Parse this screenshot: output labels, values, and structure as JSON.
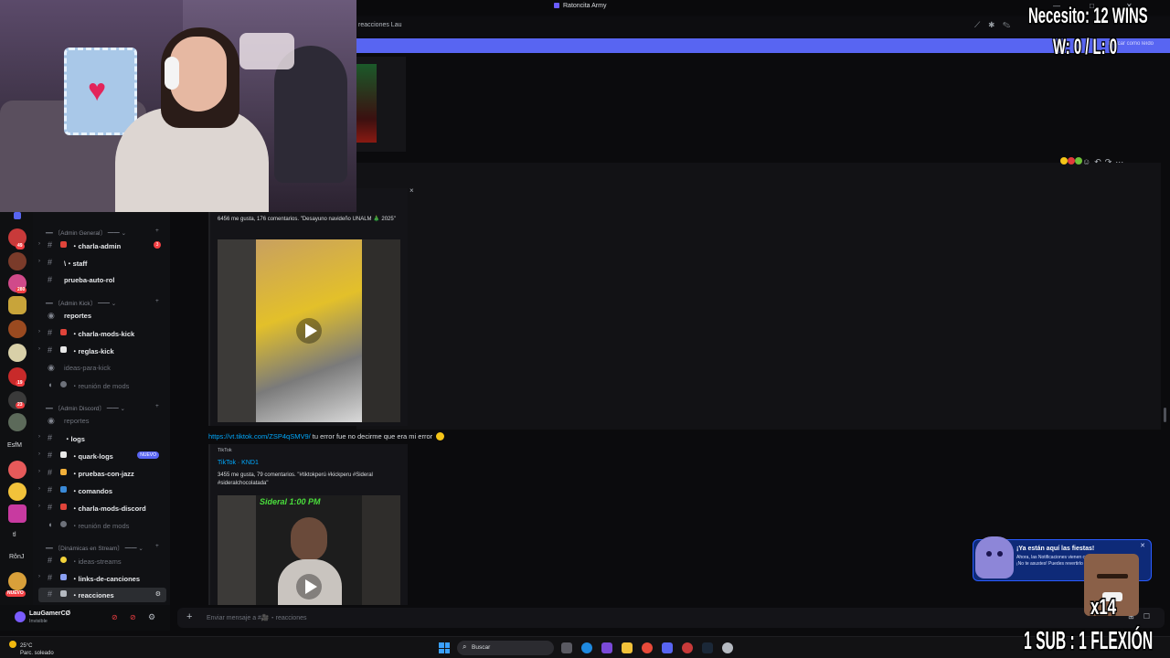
{
  "window": {
    "title": "Ratoncita Army",
    "controls": [
      "—",
      "□",
      "✕"
    ]
  },
  "header": {
    "breadcrumb": "reacciones Lau",
    "banner_chip": "Marcar como leído"
  },
  "sidebar": {
    "categories": [
      {
        "label": "━━ 〔Admin General〕 ━━ ⌄"
      },
      {
        "label": "━━ 〔Admin Kick〕 ━━ ⌄"
      },
      {
        "label": "━━ 〔Admin Discord〕 ━━ ⌄"
      },
      {
        "label": "━━ 〔Dinámicas en Stream〕 ━━ ⌄"
      }
    ],
    "channels": [
      {
        "label": "・charla-admin",
        "badge": "3"
      },
      {
        "label": "\\・staff"
      },
      {
        "label": "prueba-auto-rol"
      },
      {
        "label": "reportes"
      },
      {
        "label": "・charla-mods-kick"
      },
      {
        "label": "・reglas-kick"
      },
      {
        "label": "ideas-para-kick"
      },
      {
        "label": "・reunión de mods"
      },
      {
        "label": "reportes"
      },
      {
        "label": "・logs"
      },
      {
        "label": "・quark-logs",
        "badge": "NUEVO"
      },
      {
        "label": "・pruebas-con-jazz"
      },
      {
        "label": "・comandos"
      },
      {
        "label": "・charla-mods-discord"
      },
      {
        "label": "・reunión de mods"
      },
      {
        "label": "・ideas-streams"
      },
      {
        "label": "・links-de-canciones"
      },
      {
        "label": "・reacciones"
      }
    ],
    "server_badges": [
      "49",
      "280",
      "19",
      "23",
      "NUEVO"
    ],
    "server_labels": [
      "tl",
      "RônJ",
      "EsfM"
    ]
  },
  "user_panel": {
    "username": "LauGamerCØ",
    "status": "Invisible"
  },
  "messages": {
    "embed1": {
      "description": "6456 me gusta, 176 comentarios. \"Desayuno navideño UNALM 🎄 2025\""
    },
    "link_message": {
      "url": "https://vt.tiktok.com/ZSP4qSMV9/",
      "text": " tu error fue no decirme que era mi error "
    },
    "embed2": {
      "provider": "TikTok",
      "title": "TikTok · KND1",
      "description": "3455 me gusta, 79 comentarios. \"#tiktokperú #kickperu #Sideral #sideralchocolatada\"",
      "thumb_text": "Sideral  1:00 PM"
    }
  },
  "composer": {
    "placeholder": "Enviar mensaje a #🎥・reacciones"
  },
  "toast": {
    "title": "¡Ya están aquí las fiestas!",
    "body": "Ahora, las Notificaciones vienen con sonidos festivos. ¡No te asustes! Puedes revertirlo en los ajustes."
  },
  "taskbar": {
    "temp": "25°C",
    "weather": "Parc. soleado",
    "search_label": "Buscar"
  },
  "overlay": {
    "need": "Necesito: 12 WINS",
    "wl": "W: 0 / L: 0",
    "sub": "1 SUB : 1 FLEXIÓN",
    "multiplier": "x14"
  },
  "colors": {
    "accent": "#5865f2",
    "link": "#00a8fc",
    "danger": "#f23f43"
  }
}
